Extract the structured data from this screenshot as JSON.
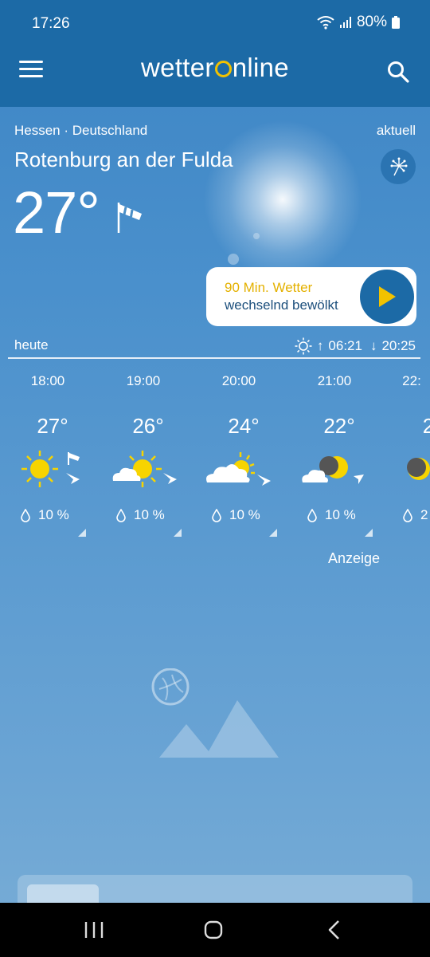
{
  "status_bar": {
    "time": "17:26",
    "battery": "80%"
  },
  "app_bar": {
    "logo_prefix": "wetter",
    "logo_suffix": "nline"
  },
  "location": {
    "region": "Hessen · Deutschland",
    "city": "Rotenburg an der Fulda",
    "current_label": "aktuell"
  },
  "current": {
    "temperature": "27°"
  },
  "card_90min": {
    "title": "90 Min. Wetter",
    "subtitle": "wechselnd bewölkt"
  },
  "today": {
    "label": "heute",
    "sunrise": "06:21",
    "sunset": "20:25"
  },
  "hourly": [
    {
      "time": "18:00",
      "temp": "27°",
      "rain": "10 %",
      "icon": "sun-icon"
    },
    {
      "time": "19:00",
      "temp": "26°",
      "rain": "10 %",
      "icon": "sun-cloud-icon"
    },
    {
      "time": "20:00",
      "temp": "24°",
      "rain": "10 %",
      "icon": "cloud-sun-icon"
    },
    {
      "time": "21:00",
      "temp": "22°",
      "rain": "10 %",
      "icon": "cloud-moon-icon"
    },
    {
      "time": "22:",
      "temp": "2",
      "rain": "2",
      "icon": "moon-icon"
    }
  ],
  "ad_label": "Anzeige",
  "colors": {
    "appbar": "#1c6aa6",
    "accent_yellow": "#f2c200",
    "card_text": "#1c4f7c"
  }
}
